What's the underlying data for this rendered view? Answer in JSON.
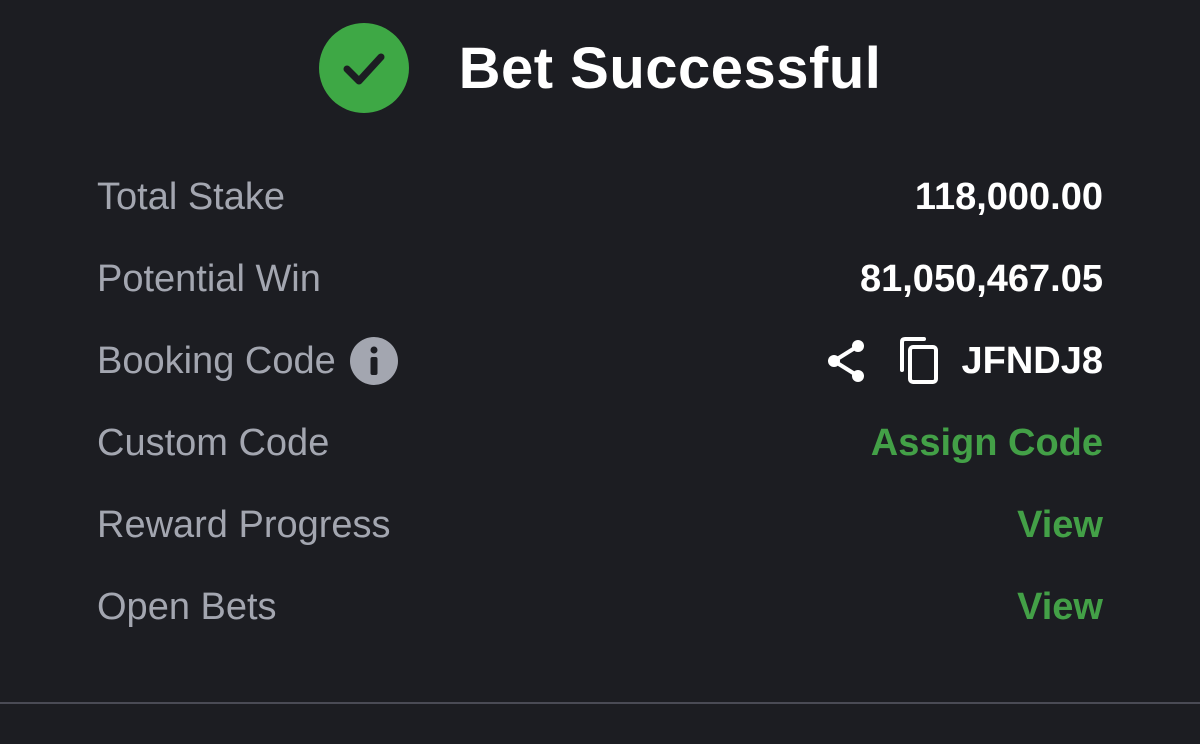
{
  "header": {
    "title": "Bet Successful"
  },
  "summary": {
    "total_stake_label": "Total Stake",
    "total_stake_value": "118,000.00",
    "potential_win_label": "Potential Win",
    "potential_win_value": "81,050,467.05",
    "booking_code_label": "Booking Code",
    "booking_code_value": "JFNDJ8",
    "custom_code_label": "Custom Code",
    "custom_code_action": "Assign Code",
    "reward_progress_label": "Reward Progress",
    "reward_progress_action": "View",
    "open_bets_label": "Open Bets",
    "open_bets_action": "View"
  },
  "icons": {
    "status": "check-circle-icon",
    "info": "info-icon",
    "share": "share-icon",
    "copy": "copy-icon"
  },
  "colors": {
    "background": "#1c1d22",
    "success": "#3ea845",
    "link": "#43a047",
    "label": "#a3a6b0",
    "value": "#ffffff"
  }
}
